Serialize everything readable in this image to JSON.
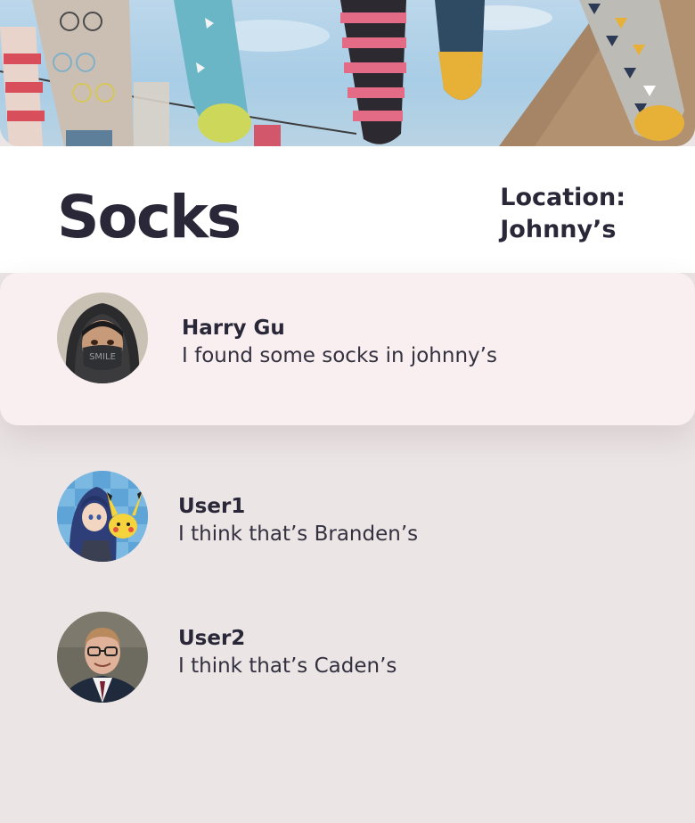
{
  "hero": {
    "image_icon": "hanging-socks-photo"
  },
  "header": {
    "title": "Socks",
    "location_label": "Location",
    "location_value": "Johnny’s"
  },
  "comments": [
    {
      "author": "Harry Gu",
      "text": "I found some socks in johnny’s",
      "avatar_icon": "hooded-anime-avatar",
      "highlighted": true
    },
    {
      "author": "User1",
      "text": "I think that’s Branden’s",
      "avatar_icon": "anime-character-avatar",
      "highlighted": false
    },
    {
      "author": "User2",
      "text": "I think that’s Caden’s",
      "avatar_icon": "man-in-suit-avatar",
      "highlighted": false
    }
  ],
  "colors": {
    "text": "#2a2838",
    "page_background": "#ebe5e5",
    "header_background": "#ffffff",
    "highlight_background": "#f9eff0"
  }
}
